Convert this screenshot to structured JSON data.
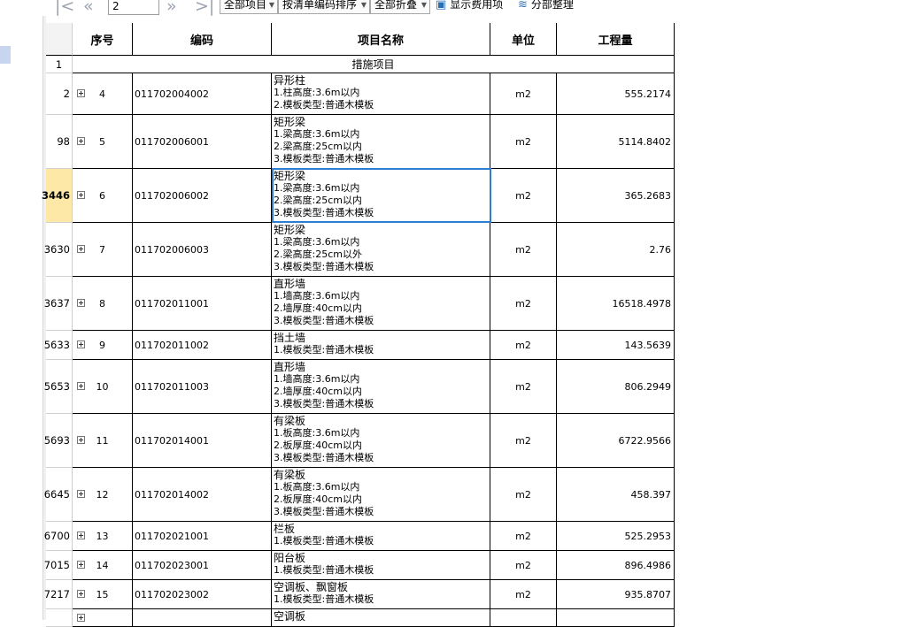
{
  "toolbar": {
    "page_value": "2",
    "filter_label": "全部项目",
    "sort_label": "按清单编码排序",
    "fold_label": "全部折叠",
    "show_fee_label": "显示费用项",
    "organize_label": "分部整理"
  },
  "table": {
    "headers": {
      "seq": "序号",
      "code": "编码",
      "name": "项目名称",
      "unit": "单位",
      "qty": "工程量"
    },
    "section": {
      "rn": "1",
      "title": "措施项目"
    },
    "rows": [
      {
        "rn": "2",
        "seq": "4",
        "code": "011702004002",
        "name": [
          "异形柱",
          "1.柱高度:3.6m以内",
          "2.模板类型:普通木模板"
        ],
        "unit": "m2",
        "qty": "555.2174"
      },
      {
        "rn": "98",
        "seq": "5",
        "code": "011702006001",
        "name": [
          "矩形梁",
          "1.梁高度:3.6m以内",
          "2.梁高度:25cm以内",
          "3.模板类型:普通木模板"
        ],
        "unit": "m2",
        "qty": "5114.8402"
      },
      {
        "rn": "3446",
        "seq": "6",
        "code": "011702006002",
        "name": [
          "矩形梁",
          "1.梁高度:3.6m以内",
          "2.梁高度:25cm以内",
          "3.模板类型:普通木模板"
        ],
        "unit": "m2",
        "qty": "365.2683"
      },
      {
        "rn": "3630",
        "seq": "7",
        "code": "011702006003",
        "name": [
          "矩形梁",
          "1.梁高度:3.6m以内",
          "2.梁高度:25cm以外",
          "3.模板类型:普通木模板"
        ],
        "unit": "m2",
        "qty": "2.76"
      },
      {
        "rn": "3637",
        "seq": "8",
        "code": "011702011001",
        "name": [
          "直形墙",
          "1.墙高度:3.6m以内",
          "2.墙厚度:40cm以内",
          "3.模板类型:普通木模板"
        ],
        "unit": "m2",
        "qty": "16518.4978"
      },
      {
        "rn": "5633",
        "seq": "9",
        "code": "011702011002",
        "name": [
          "挡土墙",
          "1.模板类型:普通木模板"
        ],
        "unit": "m2",
        "qty": "143.5639"
      },
      {
        "rn": "5653",
        "seq": "10",
        "code": "011702011003",
        "name": [
          "直形墙",
          "1.墙高度:3.6m以内",
          "2.墙厚度:40cm以内",
          "3.模板类型:普通木模板"
        ],
        "unit": "m2",
        "qty": "806.2949"
      },
      {
        "rn": "5693",
        "seq": "11",
        "code": "011702014001",
        "name": [
          "有梁板",
          "1.板高度:3.6m以内",
          "2.板厚度:40cm以内",
          "3.模板类型:普通木模板"
        ],
        "unit": "m2",
        "qty": "6722.9566"
      },
      {
        "rn": "6645",
        "seq": "12",
        "code": "011702014002",
        "name": [
          "有梁板",
          "1.板高度:3.6m以内",
          "2.板厚度:40cm以内",
          "3.模板类型:普通木模板"
        ],
        "unit": "m2",
        "qty": "458.397"
      },
      {
        "rn": "6700",
        "seq": "13",
        "code": "011702021001",
        "name": [
          "栏板",
          "1.模板类型:普通木模板"
        ],
        "unit": "m2",
        "qty": "525.2953"
      },
      {
        "rn": "7015",
        "seq": "14",
        "code": "011702023001",
        "name": [
          "阳台板",
          "1.模板类型:普通木模板"
        ],
        "unit": "m2",
        "qty": "896.4986"
      },
      {
        "rn": "7217",
        "seq": "15",
        "code": "011702023002",
        "name": [
          "空调板、飘窗板",
          "1.模板类型:普通木模板"
        ],
        "unit": "m2",
        "qty": "935.8707"
      },
      {
        "rn": "",
        "seq": "",
        "code": "",
        "name": [
          "空调板"
        ],
        "unit": "",
        "qty": ""
      }
    ]
  },
  "colors": {
    "selection": "#2d7dd2",
    "active_row_header": "#fde8a8"
  }
}
